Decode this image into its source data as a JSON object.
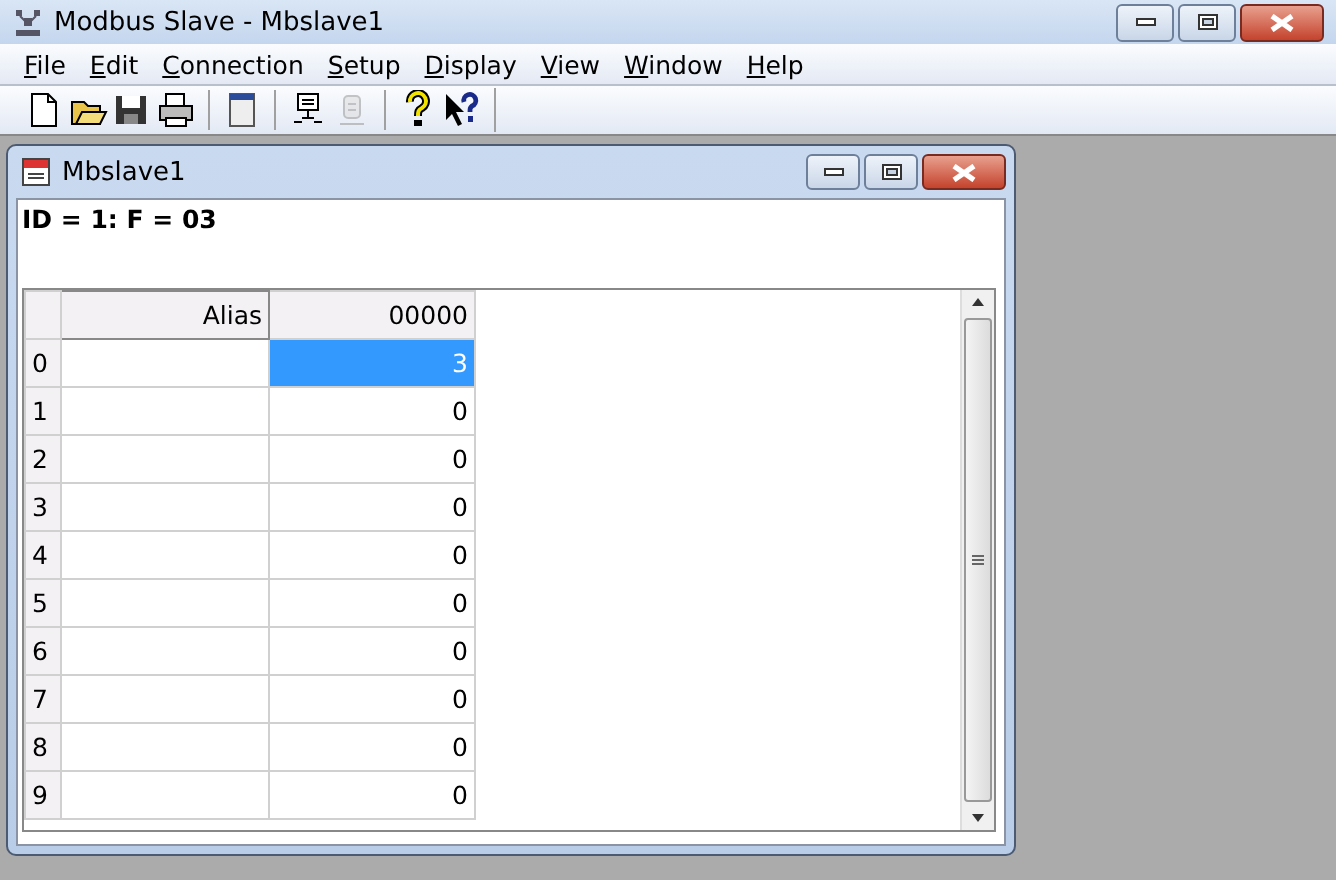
{
  "window": {
    "title": "Modbus Slave - Mbslave1"
  },
  "menu": [
    "File",
    "Edit",
    "Connection",
    "Setup",
    "Display",
    "View",
    "Window",
    "Help"
  ],
  "toolbar": [
    {
      "kind": "new",
      "disabled": false
    },
    {
      "kind": "open",
      "disabled": false
    },
    {
      "kind": "save",
      "disabled": false
    },
    {
      "kind": "print",
      "disabled": false
    },
    {
      "kind": "sep"
    },
    {
      "kind": "window",
      "disabled": false
    },
    {
      "kind": "sep"
    },
    {
      "kind": "connect",
      "disabled": false
    },
    {
      "kind": "disconnect",
      "disabled": true
    },
    {
      "kind": "sep"
    },
    {
      "kind": "help",
      "disabled": false
    },
    {
      "kind": "context-help",
      "disabled": false
    }
  ],
  "child": {
    "title": "Mbslave1",
    "info": "ID = 1: F = 03",
    "columns": [
      "Alias",
      "00000"
    ],
    "rows": [
      {
        "index": "0",
        "alias": "",
        "value": "3",
        "selected": true
      },
      {
        "index": "1",
        "alias": "",
        "value": "0",
        "selected": false
      },
      {
        "index": "2",
        "alias": "",
        "value": "0",
        "selected": false
      },
      {
        "index": "3",
        "alias": "",
        "value": "0",
        "selected": false
      },
      {
        "index": "4",
        "alias": "",
        "value": "0",
        "selected": false
      },
      {
        "index": "5",
        "alias": "",
        "value": "0",
        "selected": false
      },
      {
        "index": "6",
        "alias": "",
        "value": "0",
        "selected": false
      },
      {
        "index": "7",
        "alias": "",
        "value": "0",
        "selected": false
      },
      {
        "index": "8",
        "alias": "",
        "value": "0",
        "selected": false
      },
      {
        "index": "9",
        "alias": "",
        "value": "0",
        "selected": false
      }
    ]
  }
}
